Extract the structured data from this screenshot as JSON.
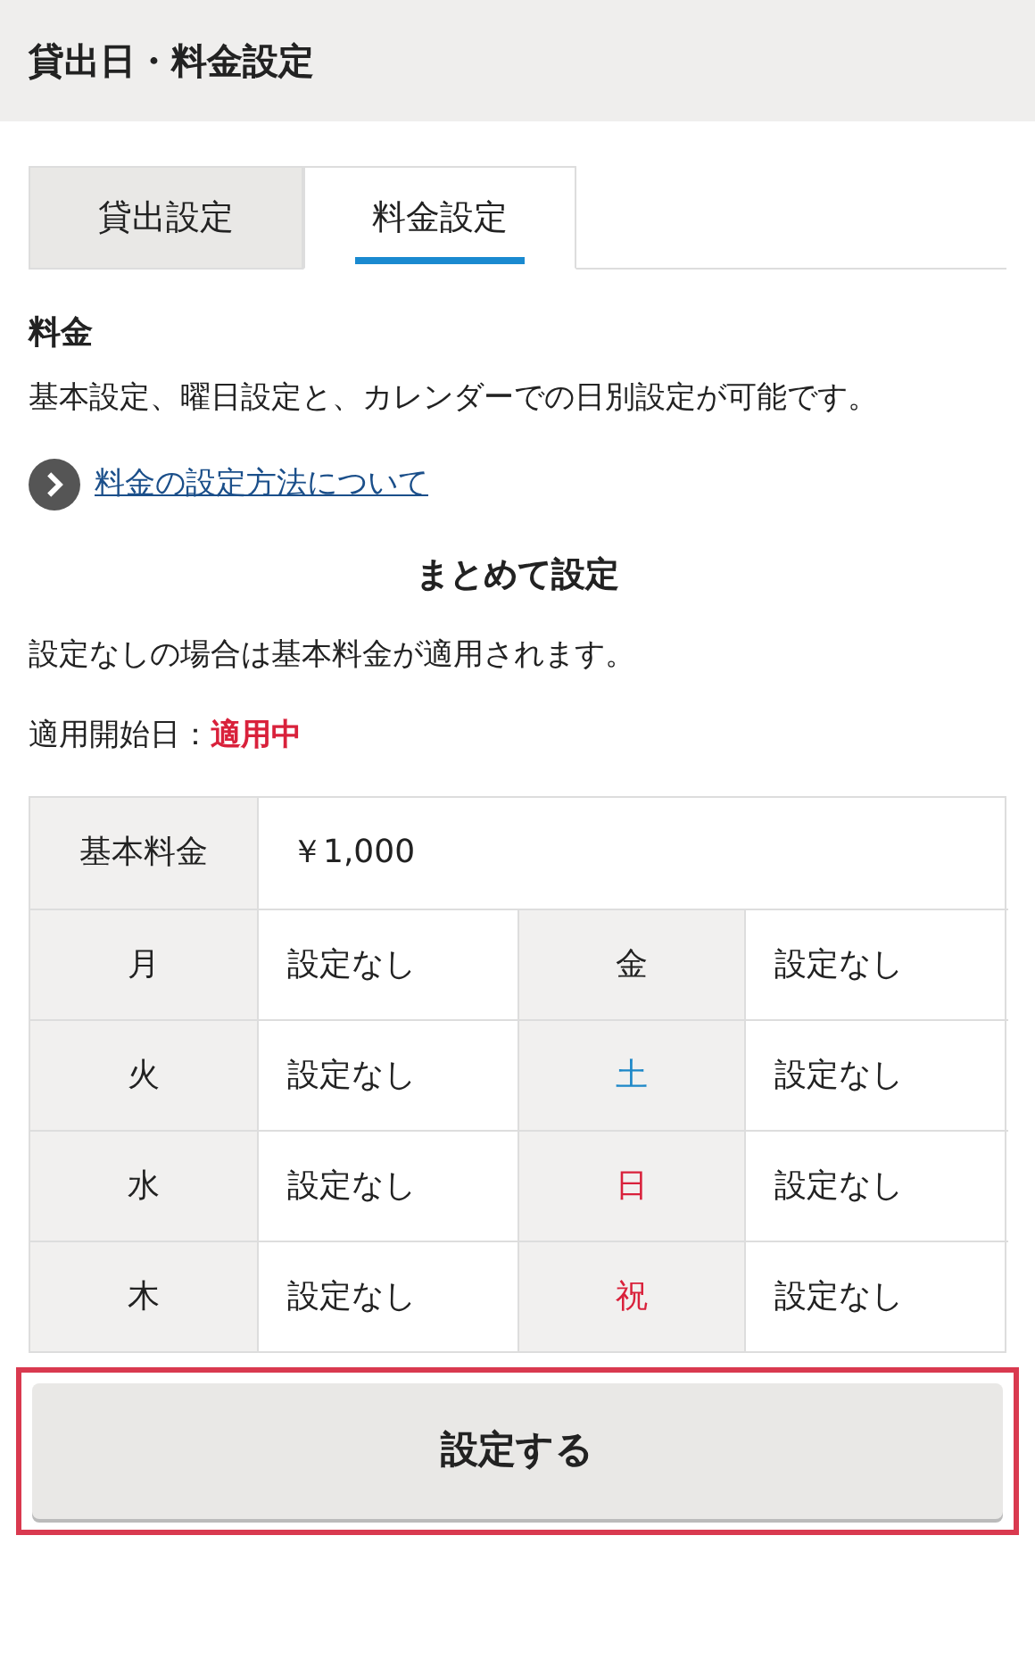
{
  "header": {
    "title": "貸出日・料金設定"
  },
  "tabs": [
    {
      "label": "貸出設定",
      "selected": false
    },
    {
      "label": "料金設定",
      "selected": true
    }
  ],
  "section": {
    "heading": "料金",
    "description": "基本設定、曜日設定と、カレンダーでの日別設定が可能です。",
    "link": "料金の設定方法について"
  },
  "bulk": {
    "heading": "まとめて設定",
    "note": "設定なしの場合は基本料金が適用されます。",
    "start_label": "適用開始日：",
    "start_value": "適用中"
  },
  "base_fee": {
    "label": "基本料金",
    "value": "￥1,000"
  },
  "days": [
    {
      "left": {
        "day": "月",
        "color": "#222222",
        "value": "設定なし"
      },
      "right": {
        "day": "金",
        "color": "#222222",
        "value": "設定なし"
      }
    },
    {
      "left": {
        "day": "火",
        "color": "#222222",
        "value": "設定なし"
      },
      "right": {
        "day": "土",
        "color": "#1e88c8",
        "value": "設定なし"
      }
    },
    {
      "left": {
        "day": "水",
        "color": "#222222",
        "value": "設定なし"
      },
      "right": {
        "day": "日",
        "color": "#d9213b",
        "value": "設定なし"
      }
    },
    {
      "left": {
        "day": "木",
        "color": "#222222",
        "value": "設定なし"
      },
      "right": {
        "day": "祝",
        "color": "#d9213b",
        "value": "設定なし"
      }
    }
  ],
  "submit": {
    "label": "設定する",
    "highlighted": true
  }
}
